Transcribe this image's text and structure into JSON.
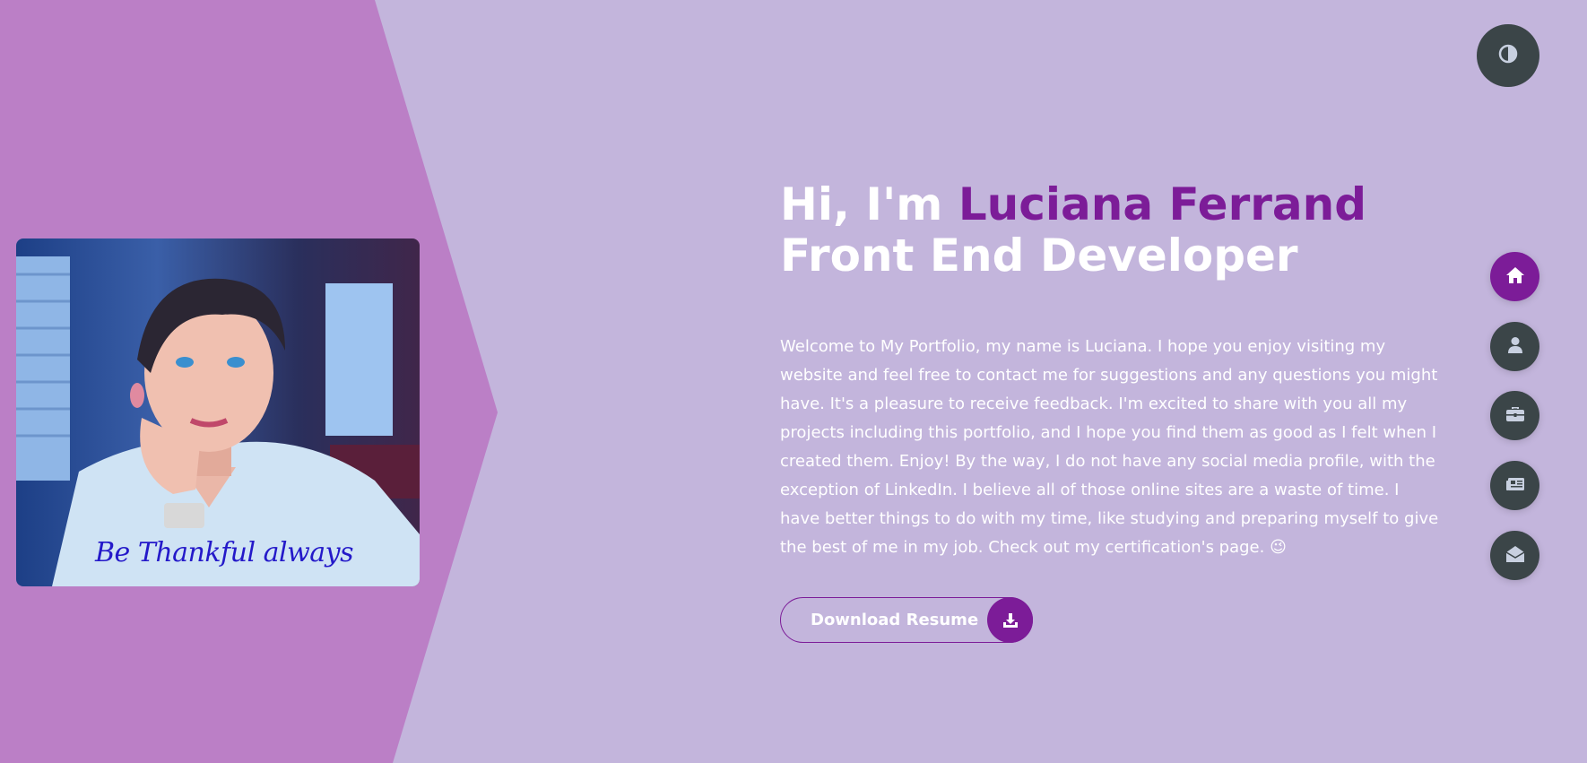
{
  "hero": {
    "greeting": "Hi, I'm ",
    "name": "Luciana Ferrand",
    "role": "Front End Developer",
    "intro": "Welcome to My Portfolio, my name is Luciana. I hope you enjoy visiting my website and feel free to contact me for suggestions and any questions you might have. It's a pleasure to receive feedback. I'm excited to share with you all my projects including this portfolio, and I hope you find them as good as I felt when I created them. Enjoy! By the way, I do not have any social media profile, with the exception of LinkedIn. I believe all of those online sites are a waste of time. I have better things to do with my time, like studying and preparing myself to give the best of me in my job. Check out my certification's page. 😉"
  },
  "photo": {
    "caption": "Be Thankful always"
  },
  "resume_button": {
    "label": "Download Resume",
    "icon": "download-icon"
  },
  "theme_toggle": {
    "icon": "contrast-icon"
  },
  "nav": {
    "items": [
      {
        "id": "home",
        "icon": "home-icon",
        "active": true
      },
      {
        "id": "about",
        "icon": "user-icon",
        "active": false
      },
      {
        "id": "portfolio",
        "icon": "briefcase-icon",
        "active": false
      },
      {
        "id": "blog",
        "icon": "newspaper-icon",
        "active": false
      },
      {
        "id": "contact",
        "icon": "envelope-open-icon",
        "active": false
      }
    ]
  },
  "colors": {
    "background": "#c3b5dc",
    "side_panel": "#bb7fc6",
    "accent": "#7c1c98",
    "button_dark": "#3b4548"
  }
}
